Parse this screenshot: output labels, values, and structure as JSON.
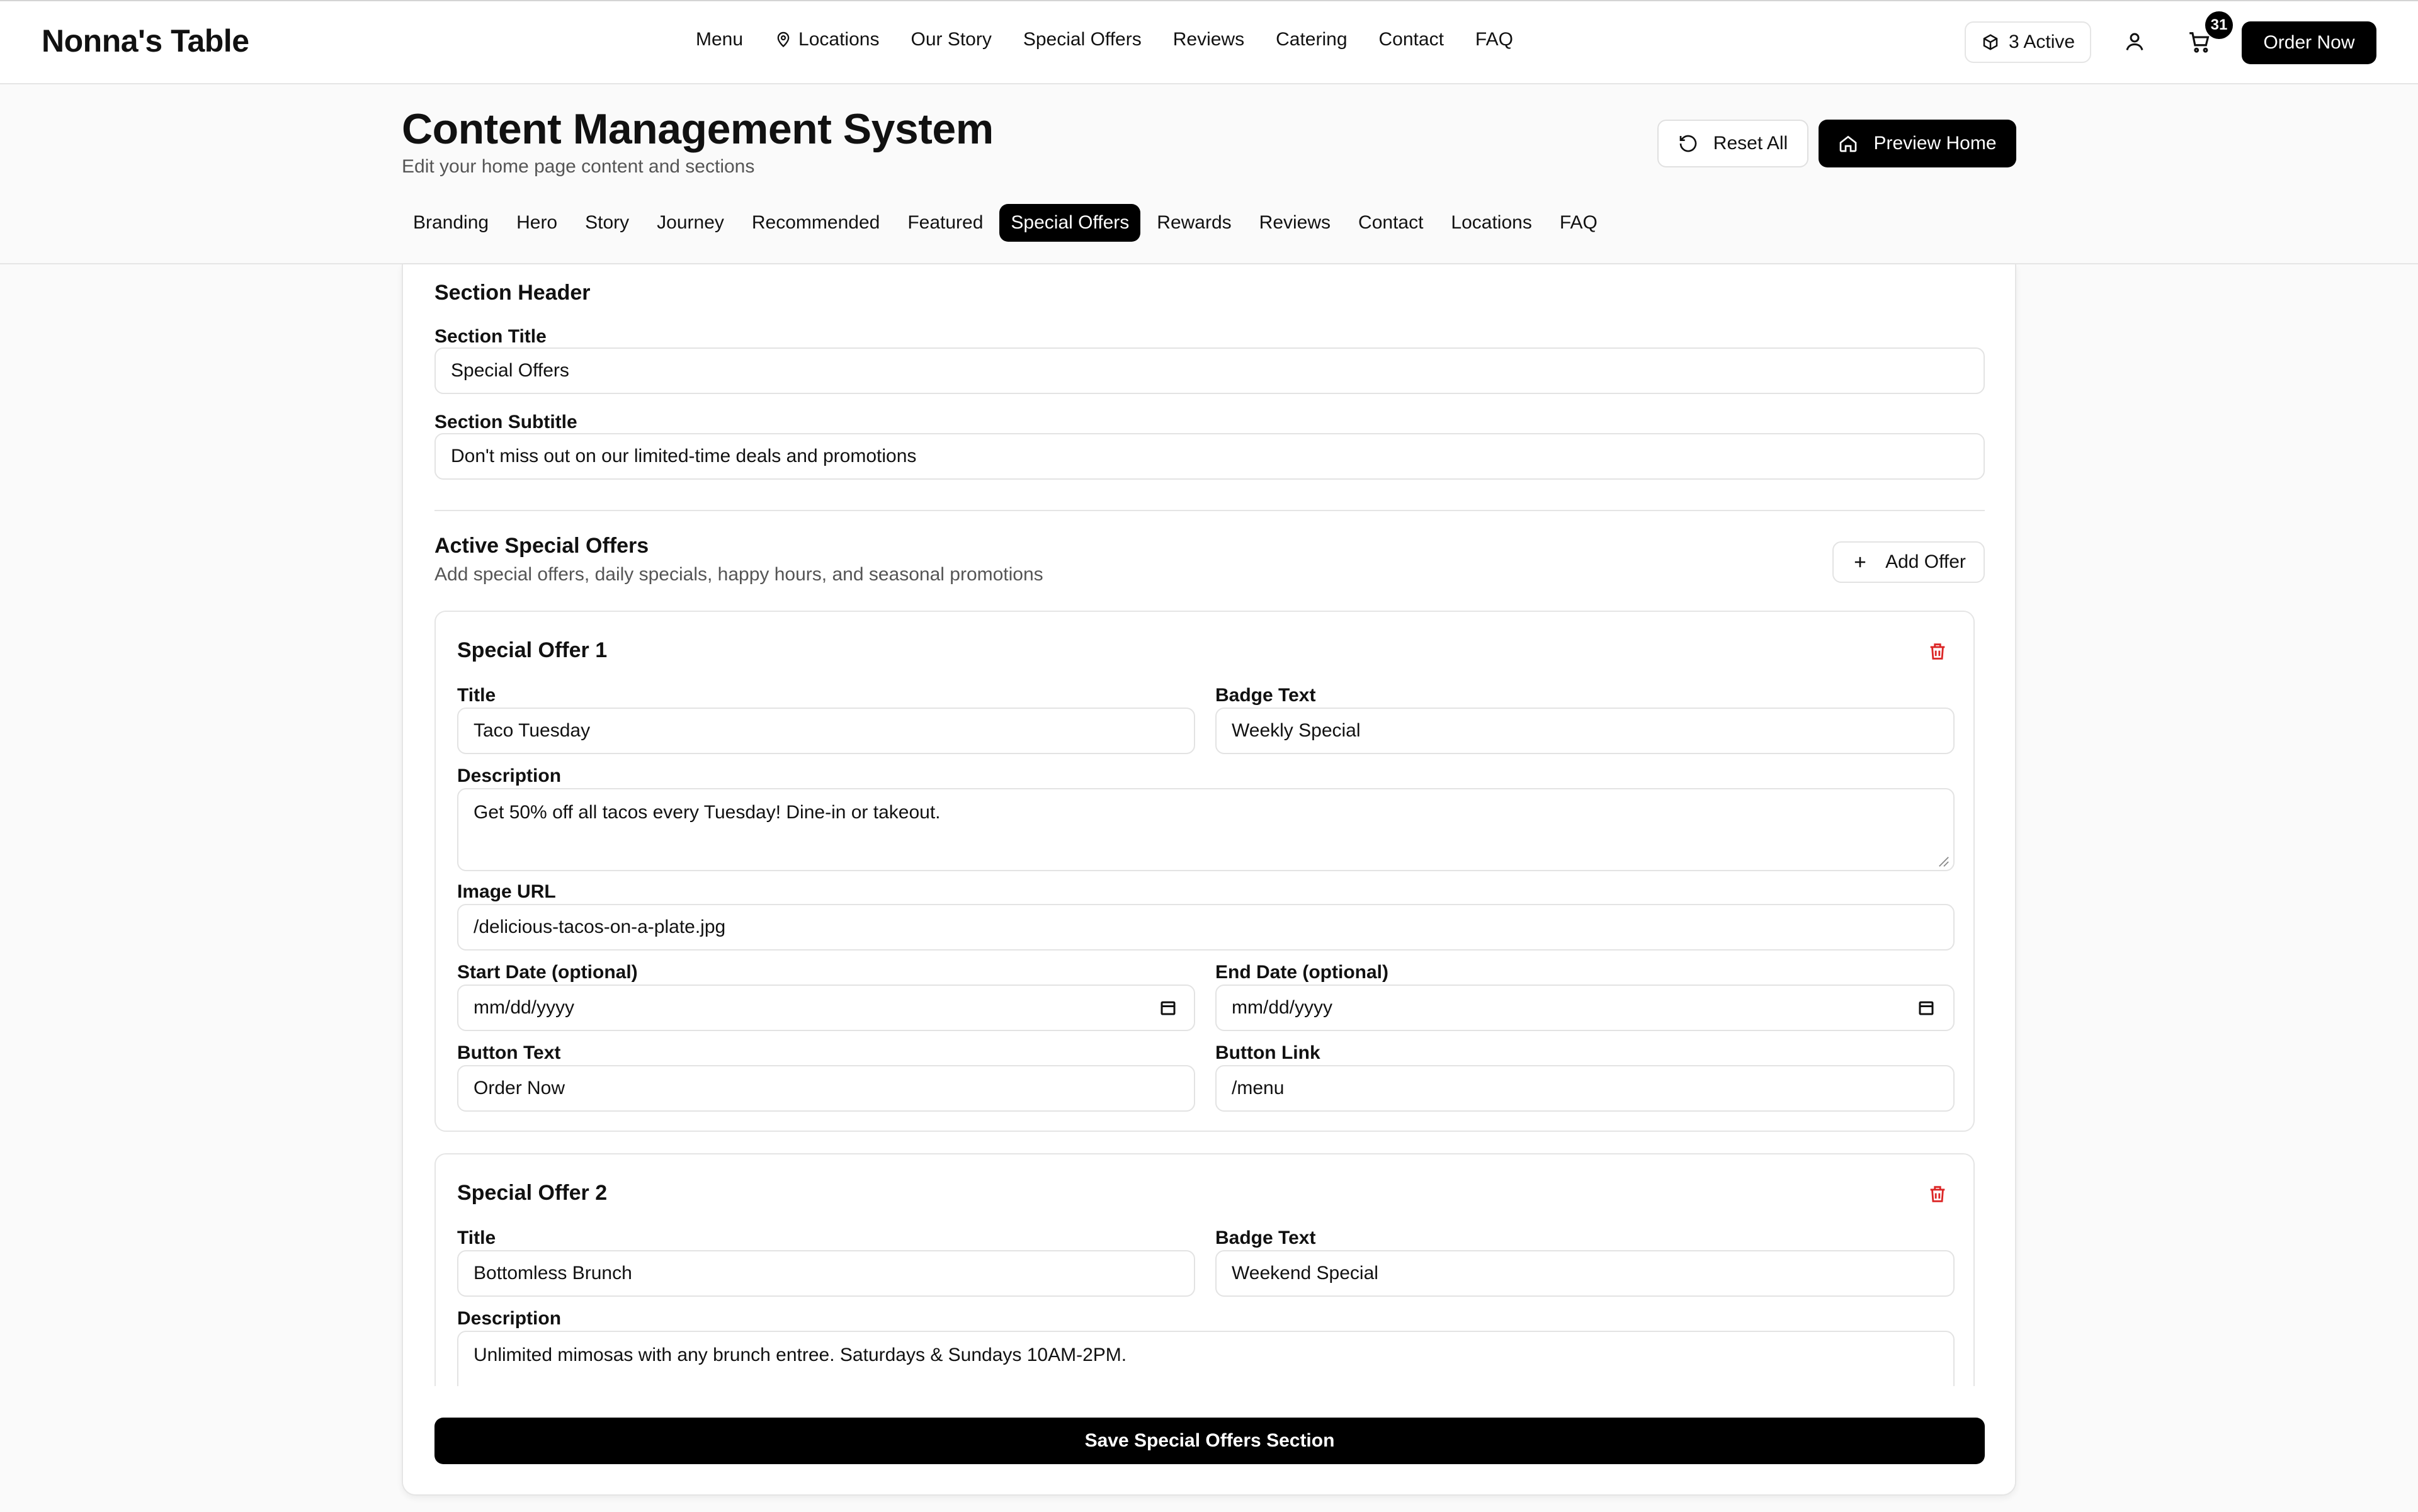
{
  "brand": "Nonna's Table",
  "nav": {
    "links": [
      "Menu",
      "Locations",
      "Our Story",
      "Special Offers",
      "Reviews",
      "Catering",
      "Contact",
      "FAQ"
    ],
    "active_count_label": "3 Active",
    "cart_count": "31",
    "order_button": "Order Now"
  },
  "header": {
    "title": "Content Management System",
    "subtitle": "Edit your home page content and sections",
    "reset_label": "Reset All",
    "preview_label": "Preview Home",
    "tabs": [
      "Branding",
      "Hero",
      "Story",
      "Journey",
      "Recommended",
      "Featured",
      "Special Offers",
      "Rewards",
      "Reviews",
      "Contact",
      "Locations",
      "FAQ"
    ],
    "active_tab": "Special Offers"
  },
  "section_header": {
    "heading": "Section Header",
    "title_label": "Section Title",
    "title_value": "Special Offers",
    "subtitle_label": "Section Subtitle",
    "subtitle_value": "Don't miss out on our limited-time deals and promotions"
  },
  "active_offers": {
    "heading": "Active Special Offers",
    "description": "Add special offers, daily specials, happy hours, and seasonal promotions",
    "add_label": "Add Offer"
  },
  "labels": {
    "title": "Title",
    "badge": "Badge Text",
    "description": "Description",
    "image": "Image URL",
    "start": "Start Date (optional)",
    "end": "End Date (optional)",
    "button_text": "Button Text",
    "button_link": "Button Link",
    "date_placeholder": "mm/dd/yyyy"
  },
  "offers": [
    {
      "heading": "Special Offer 1",
      "title": "Taco Tuesday",
      "badge": "Weekly Special",
      "description": "Get 50% off all tacos every Tuesday! Dine-in or takeout.",
      "image": "/delicious-tacos-on-a-plate.jpg",
      "button_text": "Order Now",
      "button_link": "/menu"
    },
    {
      "heading": "Special Offer 2",
      "title": "Bottomless Brunch",
      "badge": "Weekend Special",
      "description": "Unlimited mimosas with any brunch entree. Saturdays & Sundays 10AM-2PM."
    }
  ],
  "save_label": "Save Special Offers Section"
}
